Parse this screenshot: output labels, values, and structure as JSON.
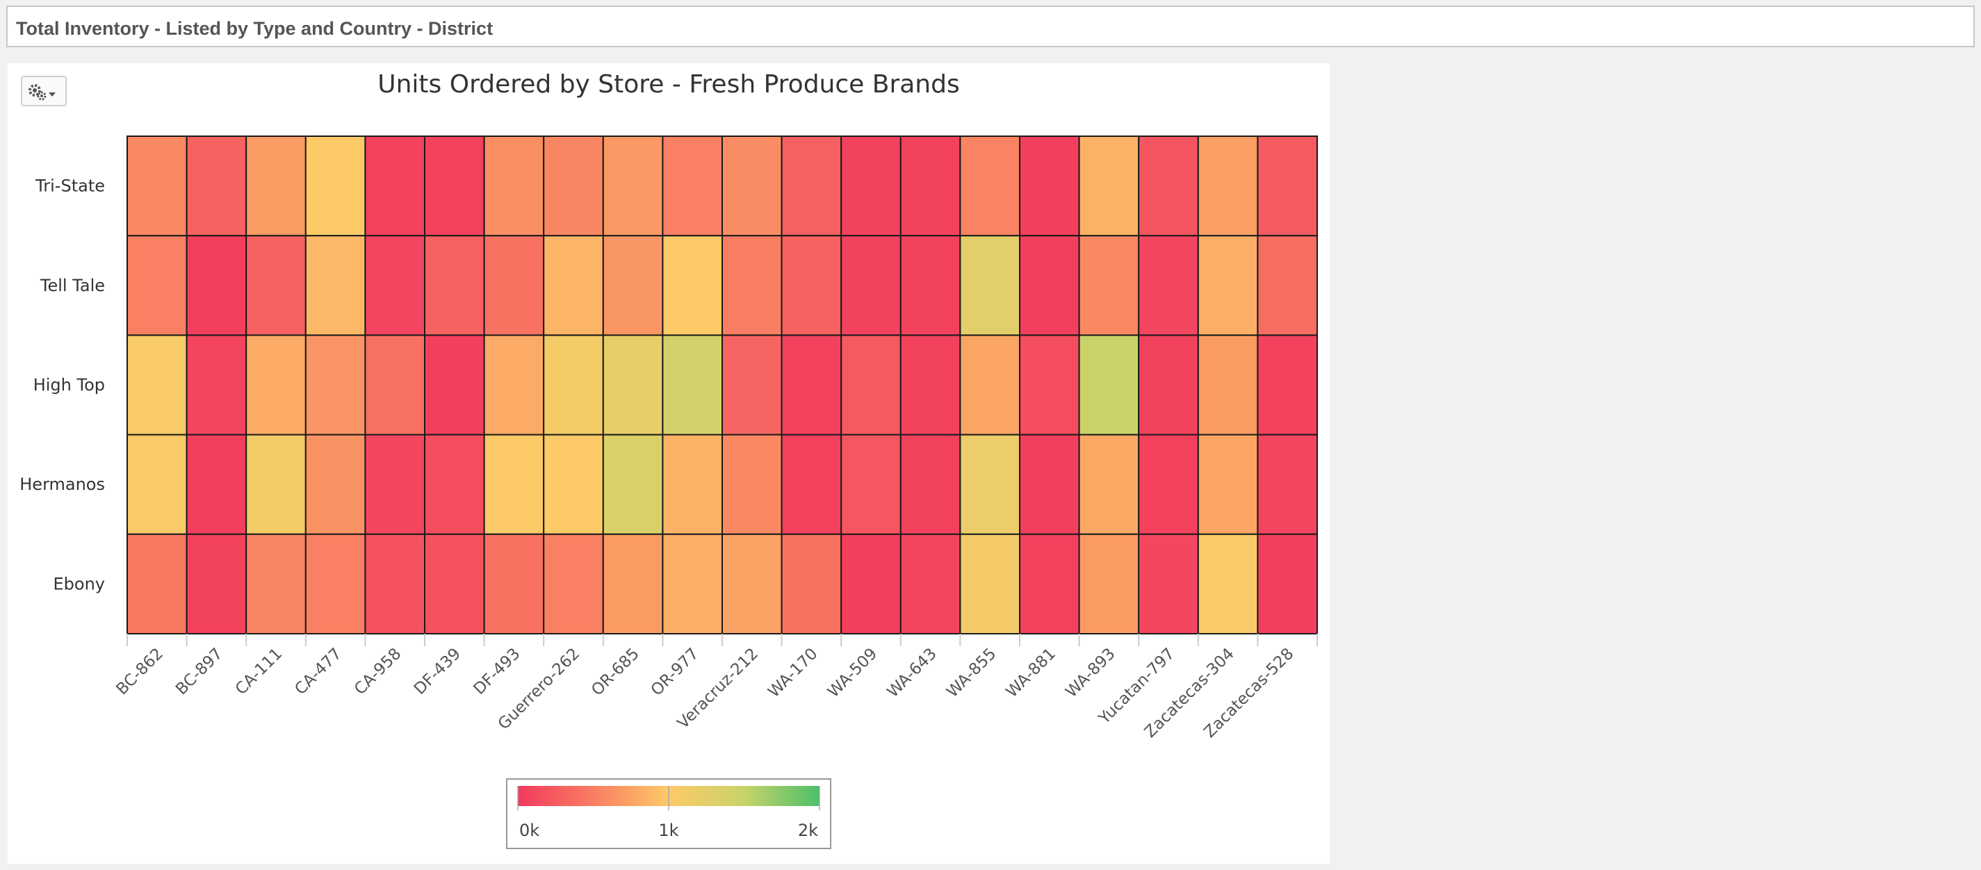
{
  "page": {
    "title": "Total Inventory - Listed by Type and Country - District"
  },
  "toolbar": {
    "menu_icon": "gear-dropdown-icon"
  },
  "colors": {
    "scale": [
      "#f23a5e",
      "#f97d62",
      "#fdca68",
      "#c9d36a",
      "#4cc06c"
    ],
    "grid": "#1a1a1a"
  },
  "chart_data": {
    "type": "heatmap",
    "title": "Units Ordered by Store - Fresh Produce Brands",
    "xlabel": "",
    "ylabel": "",
    "x": [
      "BC-862",
      "BC-897",
      "CA-111",
      "CA-477",
      "CA-958",
      "DF-439",
      "DF-493",
      "Guerrero-262",
      "OR-685",
      "OR-977",
      "Veracruz-212",
      "WA-170",
      "WA-509",
      "WA-643",
      "WA-855",
      "WA-881",
      "WA-893",
      "Yucatan-797",
      "Zacatecas-304",
      "Zacatecas-528"
    ],
    "y": [
      "Tri-State",
      "Tell Tale",
      "High Top",
      "Hermanos",
      "Ebony"
    ],
    "values": [
      [
        580,
        300,
        700,
        1000,
        50,
        50,
        620,
        560,
        680,
        520,
        600,
        280,
        60,
        60,
        540,
        40,
        850,
        200,
        720,
        240
      ],
      [
        520,
        40,
        300,
        880,
        80,
        300,
        420,
        860,
        660,
        1000,
        500,
        300,
        60,
        60,
        1250,
        40,
        580,
        80,
        820,
        380
      ],
      [
        1050,
        80,
        800,
        650,
        400,
        40,
        800,
        1100,
        1200,
        1400,
        320,
        50,
        240,
        60,
        760,
        140,
        1500,
        60,
        700,
        50
      ],
      [
        1020,
        40,
        1100,
        640,
        100,
        150,
        1000,
        1000,
        1350,
        850,
        580,
        50,
        220,
        60,
        1150,
        40,
        780,
        50,
        760,
        80
      ],
      [
        460,
        60,
        560,
        520,
        180,
        180,
        420,
        520,
        700,
        820,
        740,
        420,
        40,
        80,
        1080,
        50,
        700,
        100,
        1050,
        40
      ]
    ],
    "colorscale": {
      "min": 0,
      "max": 2000,
      "labels": [
        "0k",
        "1k",
        "2k"
      ]
    },
    "legend_position": "bottom-center"
  }
}
